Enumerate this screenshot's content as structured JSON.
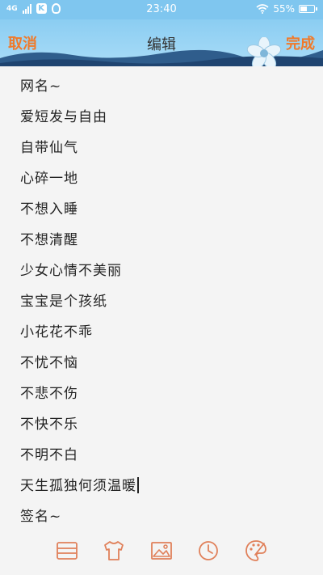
{
  "status_bar": {
    "network": "4G",
    "time": "23:40",
    "battery": "55%",
    "battery_level": 0.55
  },
  "header": {
    "cancel_label": "取消",
    "title": "编辑",
    "done_label": "完成"
  },
  "content": {
    "lines": [
      "网名~",
      "爱短发与自由",
      "自带仙气",
      "心碎一地",
      "不想入睡",
      "不想清醒",
      "少女心情不美丽",
      "宝宝是个孩纸",
      "小花花不乖",
      "不忧不恼",
      "不悲不伤",
      "不快不乐",
      "不明不白",
      "天生孤独何须温暖",
      "签名~"
    ]
  },
  "toolbar": {
    "icons": [
      "list-icon",
      "tshirt-icon",
      "image-icon",
      "clock-icon",
      "palette-icon"
    ],
    "accent": "#e0805a"
  },
  "colors": {
    "status_bar": "#7fc6ef",
    "header_button": "#f07a2a",
    "background": "#f4f4f4"
  }
}
